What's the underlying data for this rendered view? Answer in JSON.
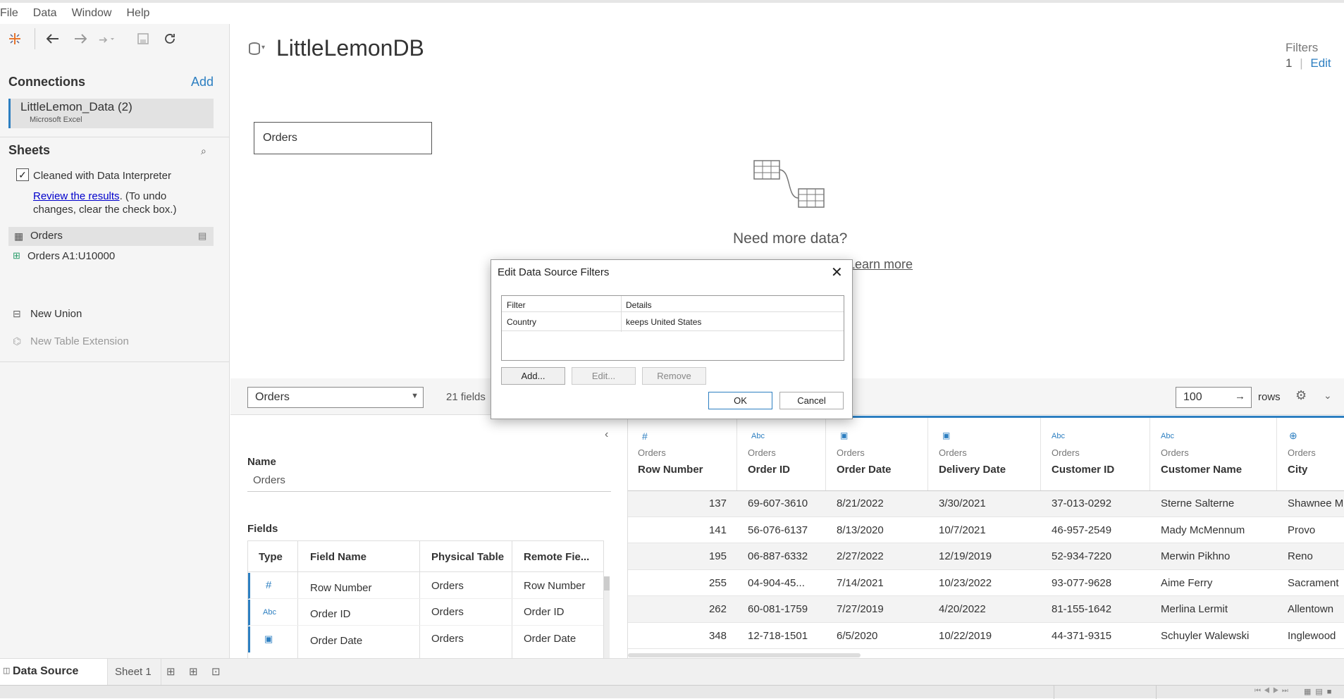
{
  "menu": [
    "File",
    "Data",
    "Window",
    "Help"
  ],
  "toolbar_icons": [
    "tableau-logo-icon",
    "undo-icon",
    "redo-icon",
    "forward-icon",
    "save-icon",
    "refresh-icon"
  ],
  "connections": {
    "title": "Connections",
    "add_label": "Add",
    "item_name": "LittleLemon_Data (2)",
    "item_type": "Microsoft Excel"
  },
  "sheets": {
    "title": "Sheets",
    "interpreter_label": "Cleaned with Data Interpreter",
    "review_link": "Review the results",
    "review_rest_1": ". (To undo",
    "review_rest_2": "changes, clear the check box.)",
    "items": [
      "Orders",
      "Orders A1:U10000"
    ],
    "new_union": "New Union",
    "new_table_extension": "New Table Extension"
  },
  "header": {
    "db_title": "LittleLemonDB",
    "filters_label": "Filters",
    "filters_count": "1",
    "filters_edit": "Edit"
  },
  "canvas": {
    "table_box": "Orders",
    "need_more": "Need more data?",
    "learn_more": "Learn more"
  },
  "lower_toolbar": {
    "table_select": "Orders",
    "fields_count": "21 fields",
    "rows_value": "100",
    "rows_label": "rows"
  },
  "meta": {
    "name_label": "Name",
    "name_value": "Orders",
    "fields_label": "Fields",
    "columns": [
      "Type",
      "Field Name",
      "Physical Table",
      "Remote Fie..."
    ],
    "rows": [
      {
        "type": "#",
        "name": "Row Number",
        "table": "Orders",
        "remote": "Row Number"
      },
      {
        "type": "Abc",
        "name": "Order ID",
        "table": "Orders",
        "remote": "Order ID"
      },
      {
        "type": "date",
        "name": "Order Date",
        "table": "Orders",
        "remote": "Order Date"
      }
    ]
  },
  "grid": {
    "columns": [
      {
        "type": "#",
        "source": "Orders",
        "name": "Row Number"
      },
      {
        "type": "Abc",
        "source": "Orders",
        "name": "Order ID"
      },
      {
        "type": "date",
        "source": "Orders",
        "name": "Order Date"
      },
      {
        "type": "date",
        "source": "Orders",
        "name": "Delivery Date"
      },
      {
        "type": "Abc",
        "source": "Orders",
        "name": "Customer ID"
      },
      {
        "type": "Abc",
        "source": "Orders",
        "name": "Customer Name"
      },
      {
        "type": "globe",
        "source": "Orders",
        "name": "City"
      }
    ],
    "rows": [
      [
        "137",
        "69-607-3610",
        "8/21/2022",
        "3/30/2021",
        "37-013-0292",
        "Sterne Salterne",
        "Shawnee M"
      ],
      [
        "141",
        "56-076-6137",
        "8/13/2020",
        "10/7/2021",
        "46-957-2549",
        "Mady McMennum",
        "Provo"
      ],
      [
        "195",
        "06-887-6332",
        "2/27/2022",
        "12/19/2019",
        "52-934-7220",
        "Merwin Pikhno",
        "Reno"
      ],
      [
        "255",
        "04-904-45...",
        "7/14/2021",
        "10/23/2022",
        "93-077-9628",
        "Aime Ferry",
        "Sacrament"
      ],
      [
        "262",
        "60-081-1759",
        "7/27/2019",
        "4/20/2022",
        "81-155-1642",
        "Merlina Lermit",
        "Allentown"
      ],
      [
        "348",
        "12-718-1501",
        "6/5/2020",
        "10/22/2019",
        "44-371-9315",
        "Schuyler Walewski",
        "Inglewood"
      ]
    ]
  },
  "bottom": {
    "data_source_tab": "Data Source",
    "sheet_tab": "Sheet 1"
  },
  "dialog": {
    "title": "Edit Data Source Filters",
    "col_filter": "Filter",
    "col_details": "Details",
    "filter_name": "Country",
    "filter_details": "keeps United States",
    "add": "Add...",
    "edit": "Edit...",
    "remove": "Remove",
    "ok": "OK",
    "cancel": "Cancel"
  },
  "colors": {
    "accent": "#2d7fc1",
    "panel": "#f5f5f5"
  }
}
